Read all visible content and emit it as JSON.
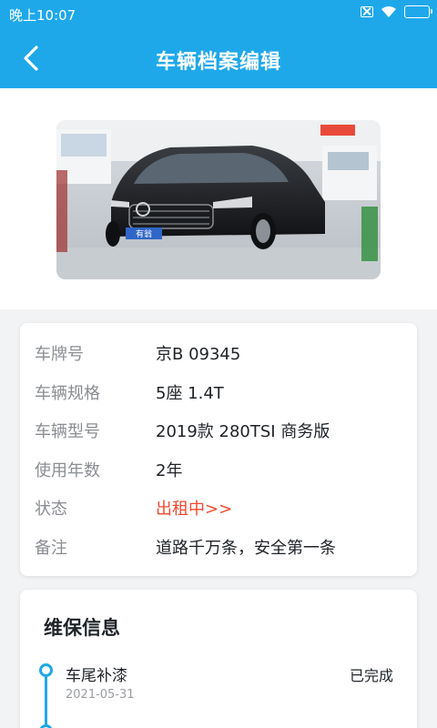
{
  "status_bar": {
    "time": "晚上10:07"
  },
  "nav": {
    "title": "车辆档案编辑"
  },
  "vehicle": {
    "photo_alt": "vehicle-photo",
    "plate_text": "有翁",
    "fields": [
      {
        "label": "车牌号",
        "value": "京B 09345"
      },
      {
        "label": "车辆规格",
        "value": "5座 1.4T"
      },
      {
        "label": "车辆型号",
        "value": "2019款 280TSI 商务版"
      },
      {
        "label": "使用年数",
        "value": "2年"
      },
      {
        "label": "状态",
        "value": "出租中>>"
      },
      {
        "label": "备注",
        "value": "道路千万条，安全第一条"
      }
    ]
  },
  "maintenance": {
    "title": "维保信息",
    "items": [
      {
        "name": "车尾补漆",
        "date": "2021-05-31",
        "status": "已完成"
      }
    ]
  },
  "colors": {
    "primary": "#1ea8ea",
    "status_red": "#f2492f"
  }
}
